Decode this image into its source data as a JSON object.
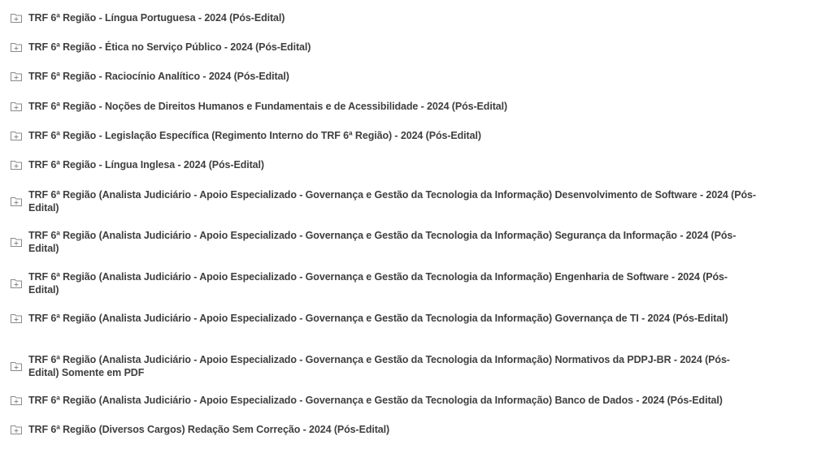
{
  "folder_icon": "folder-plus-icon",
  "items": [
    {
      "label": "TRF 6ª Região - Língua Portuguesa - 2024 (Pós-Edital)"
    },
    {
      "label": "TRF 6ª Região - Ética no Serviço Público - 2024 (Pós-Edital)"
    },
    {
      "label": "TRF 6ª Região - Raciocínio Analítico - 2024 (Pós-Edital)"
    },
    {
      "label": "TRF 6ª Região - Noções de Direitos Humanos e Fundamentais e de Acessibilidade - 2024 (Pós-Edital)"
    },
    {
      "label": "TRF 6ª Região - Legislação Específica (Regimento Interno do TRF 6ª Região) - 2024 (Pós-Edital)"
    },
    {
      "label": "TRF 6ª Região - Língua Inglesa - 2024 (Pós-Edital)"
    },
    {
      "label": "TRF 6ª Região (Analista Judiciário - Apoio Especializado - Governança e Gestão da Tecnologia da Informação) Desenvolvimento de Software - 2024 (Pós-Edital)"
    },
    {
      "label": "TRF 6ª Região (Analista Judiciário - Apoio Especializado - Governança e Gestão da Tecnologia da Informação) Segurança da Informação - 2024 (Pós-Edital)"
    },
    {
      "label": "TRF 6ª Região (Analista Judiciário - Apoio Especializado - Governança e Gestão da Tecnologia da Informação) Engenharia de Software - 2024 (Pós-Edital)"
    },
    {
      "label": "TRF 6ª Região (Analista Judiciário - Apoio Especializado - Governança e Gestão da Tecnologia da Informação) Governança de TI - 2024 (Pós-Edital)"
    },
    {
      "label": "TRF 6ª Região (Analista Judiciário - Apoio Especializado - Governança e Gestão da Tecnologia da Informação) Normativos da PDPJ-BR - 2024 (Pós-Edital) Somente em PDF"
    },
    {
      "label": "TRF 6ª Região (Analista Judiciário - Apoio Especializado - Governança e Gestão da Tecnologia da Informação) Banco de Dados - 2024 (Pós-Edital)"
    },
    {
      "label": "TRF 6ª Região (Diversos Cargos) Redação Sem Correção - 2024 (Pós-Edital)"
    }
  ]
}
